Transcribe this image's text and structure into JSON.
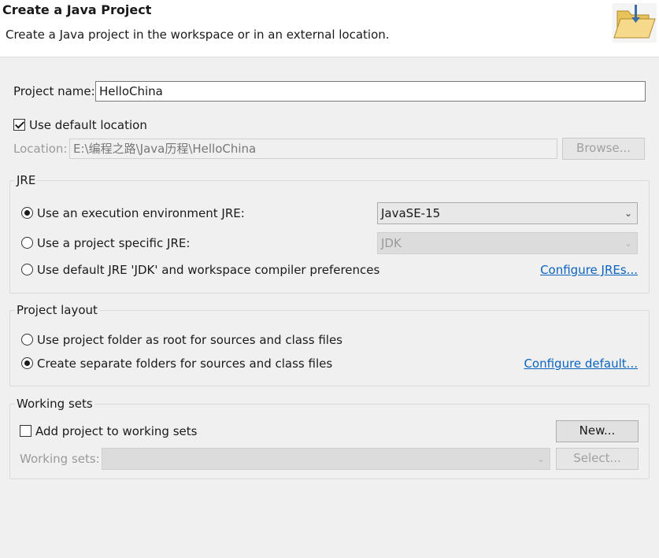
{
  "header": {
    "title": "Create a Java Project",
    "description": "Create a Java project in the workspace or in an external location."
  },
  "project_name": {
    "label": "Project name:",
    "value": "HelloChina"
  },
  "use_default_location": {
    "label": "Use default location",
    "checked": true
  },
  "location": {
    "label": "Location:",
    "value": "E:\\编程之路\\Java历程\\HelloChina",
    "browse_label": "Browse..."
  },
  "jre": {
    "title": "JRE",
    "option_env_label": "Use an execution environment JRE:",
    "env_value": "JavaSE-15",
    "option_specific_label": "Use a project specific JRE:",
    "specific_value": "JDK",
    "option_default_label": "Use default JRE 'JDK' and workspace compiler preferences",
    "configure_link": "Configure JREs..."
  },
  "layout": {
    "title": "Project layout",
    "option_root_label": "Use project folder as root for sources and class files",
    "option_separate_label": "Create separate folders for sources and class files",
    "configure_link": "Configure default..."
  },
  "working_sets": {
    "title": "Working sets",
    "add_label": "Add project to working sets",
    "new_button": "New...",
    "sets_label": "Working sets:",
    "select_button": "Select..."
  }
}
